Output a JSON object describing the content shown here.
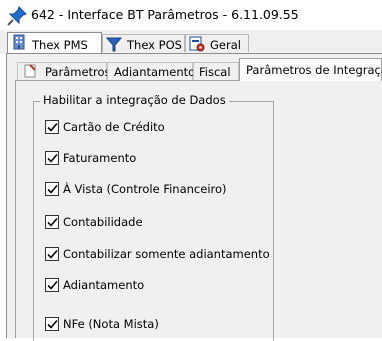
{
  "window": {
    "title": "642 - Interface BT Parâmetros - 6.11.09.55",
    "icon": "pushpin-icon"
  },
  "main_tabs": [
    {
      "label": "Thex PMS",
      "icon": "building-icon",
      "active": true
    },
    {
      "label": "Thex POS",
      "icon": "funnel-icon",
      "active": false
    },
    {
      "label": "Geral",
      "icon": "settings-doc-icon",
      "active": false
    }
  ],
  "sub_tabs": [
    {
      "label": "Parâmetros",
      "icon": "document-icon",
      "active": false
    },
    {
      "label": "Adiantamento",
      "active": false
    },
    {
      "label": "Fiscal",
      "active": false
    },
    {
      "label": "Parâmetros de Integração",
      "active": true
    }
  ],
  "group": {
    "title": "Habilitar a integração de Dados",
    "options": [
      {
        "label": "Cartão de Crédito",
        "checked": true
      },
      {
        "label": "Faturamento",
        "checked": true
      },
      {
        "label": "À Vista (Controle Financeiro)",
        "checked": true
      },
      {
        "label": "Contabilidade",
        "checked": true
      },
      {
        "label": "Contabilizar somente adiantamento",
        "checked": true
      },
      {
        "label": "Adiantamento",
        "checked": true
      },
      {
        "label": "NFe (Nota Mista)",
        "checked": true
      }
    ]
  }
}
